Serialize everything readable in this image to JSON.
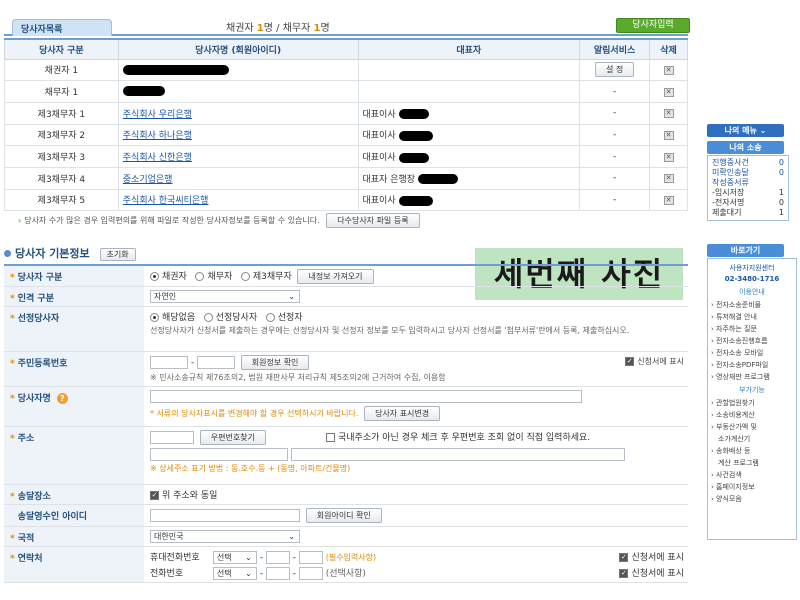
{
  "header": {
    "tab_label": "당사자목록",
    "counts_prefix": "채권자",
    "creditor_count": "1",
    "counts_mid": "명 / 채무자",
    "debtor_count": "1",
    "counts_suffix": "명",
    "add_party_button": "당사자입력"
  },
  "party_table": {
    "columns": [
      "당사자 구분",
      "당사자명 (회원아이디)",
      "대표자",
      "알림서비스",
      "삭제"
    ],
    "rows": [
      {
        "type": "채권자 1",
        "name": "",
        "rep": "",
        "alert": "설 정"
      },
      {
        "type": "채무자 1",
        "name": "",
        "rep": "",
        "alert": "-"
      },
      {
        "type": "제3채무자 1",
        "name": "주식회사 우리은행",
        "rep": "대표이사",
        "alert": "-"
      },
      {
        "type": "제3채무자 2",
        "name": "주식회사 하나은행",
        "rep": "대표이사",
        "alert": "-"
      },
      {
        "type": "제3채무자 3",
        "name": "주식회사 신한은행",
        "rep": "대표이사",
        "alert": "-"
      },
      {
        "type": "제3채무자 4",
        "name": "중소기업은행",
        "rep": "대표자 은행장",
        "alert": "-"
      },
      {
        "type": "제3채무자 5",
        "name": "주식회사 한국씨티은행",
        "rep": "대표이사",
        "alert": "-"
      }
    ],
    "delete_glyph": "✕"
  },
  "notice": {
    "text": "당사자 수가 많은 경우 입력편의를 위해 파일로 작성한 당사자정보를 등록할 수 있습니다.",
    "button": "다수당사자 파일 등록"
  },
  "basic_info": {
    "title": "당사자 기본정보",
    "reset_button": "초기화",
    "photo_label": "세번째 사진"
  },
  "form": {
    "party_type": {
      "label": "당사자 구분",
      "options": [
        "채권자",
        "채무자",
        "제3채무자"
      ],
      "selected": "채권자",
      "load_button": "내정보 가져오기"
    },
    "person_type": {
      "label": "인격 구분",
      "value": "자연인"
    },
    "appointed": {
      "label": "선정당사자",
      "options": [
        "해당없음",
        "선정당사자",
        "선정자"
      ],
      "selected": "해당없음",
      "help": "선정당사자가 신청서를 제출하는 경우에는 선정당사자 및 선정자 정보를 모두 입력하시고 당사자 선정서를 '첨부서류'란에서 등록, 제출하십시오."
    },
    "resident_no": {
      "label": "주민등록번호",
      "check_button": "회원정보 확인",
      "show_label": "신청서에 표시",
      "help": "※ 민사소송규칙 제76조의2, 법원 재판사무 처리규칙 제5조의2에 근거하여 수집, 이용함"
    },
    "party_name": {
      "label": "당사자명",
      "warn": "* 서류의 당사자표시를 변경해야 할 경우 선택하시기 바랍니다.",
      "button": "당사자 표시변경"
    },
    "address": {
      "label": "주소",
      "zip_button": "우편번호찾기",
      "foreign_check": "국내주소가 아닌 경우 체크 후 우편번호 조회 없이 직접 입력하세요.",
      "warn": "※ 상세주소 표기 방법 : 동.호수.등 + (동명, 아파트/건물명)"
    },
    "delivery": {
      "label": "송달장소",
      "same_check": "위 주소와 동일"
    },
    "delivery_id": {
      "label": "송달영수인 아이디",
      "button": "회원아이디 확인"
    },
    "nationality": {
      "label": "국적",
      "value": "대한민국"
    },
    "contact": {
      "label": "연락처",
      "mobile_label": "휴대전화번호",
      "mobile_select": "선택",
      "mobile_note": "(필수입력사항)",
      "phone_label": "전화번호",
      "phone_select": "선택",
      "phone_note": "(선택사항)",
      "show_label": "신청서에 표시"
    }
  },
  "sidebar": {
    "my_menu": "나의 메뉴",
    "my_case": "나의 소송",
    "cases": [
      {
        "label": "진행중사건",
        "count": "0"
      },
      {
        "label": "미확인송달",
        "count": "0"
      },
      {
        "label": "작성중서류",
        "count": ""
      },
      {
        "label": "-임시저장",
        "count": "1"
      },
      {
        "label": "-전자서명",
        "count": "0"
      },
      {
        "label": "제출대기",
        "count": "1"
      }
    ],
    "shortcut": "바로가기",
    "center_name": "사용자지원센터",
    "center_phone": "02-3480-1716",
    "guide_title": "이용안내",
    "guide_items": [
      "전자소송준비물",
      "튜저해결 안내",
      "자주하는 질문",
      "전자소송진행흐름",
      "전자소송 모바일",
      "전자소송PDF파일",
      "영상재판 프로그램"
    ],
    "extra_title": "부가기능",
    "extra_items": [
      "관할법원찾기",
      "소송비용계산",
      "부동산가액 및",
      "소가계산기",
      "송화배상 등",
      "계산 프로그램",
      "사건검색",
      "홈페이지정보",
      "양식모음"
    ]
  }
}
